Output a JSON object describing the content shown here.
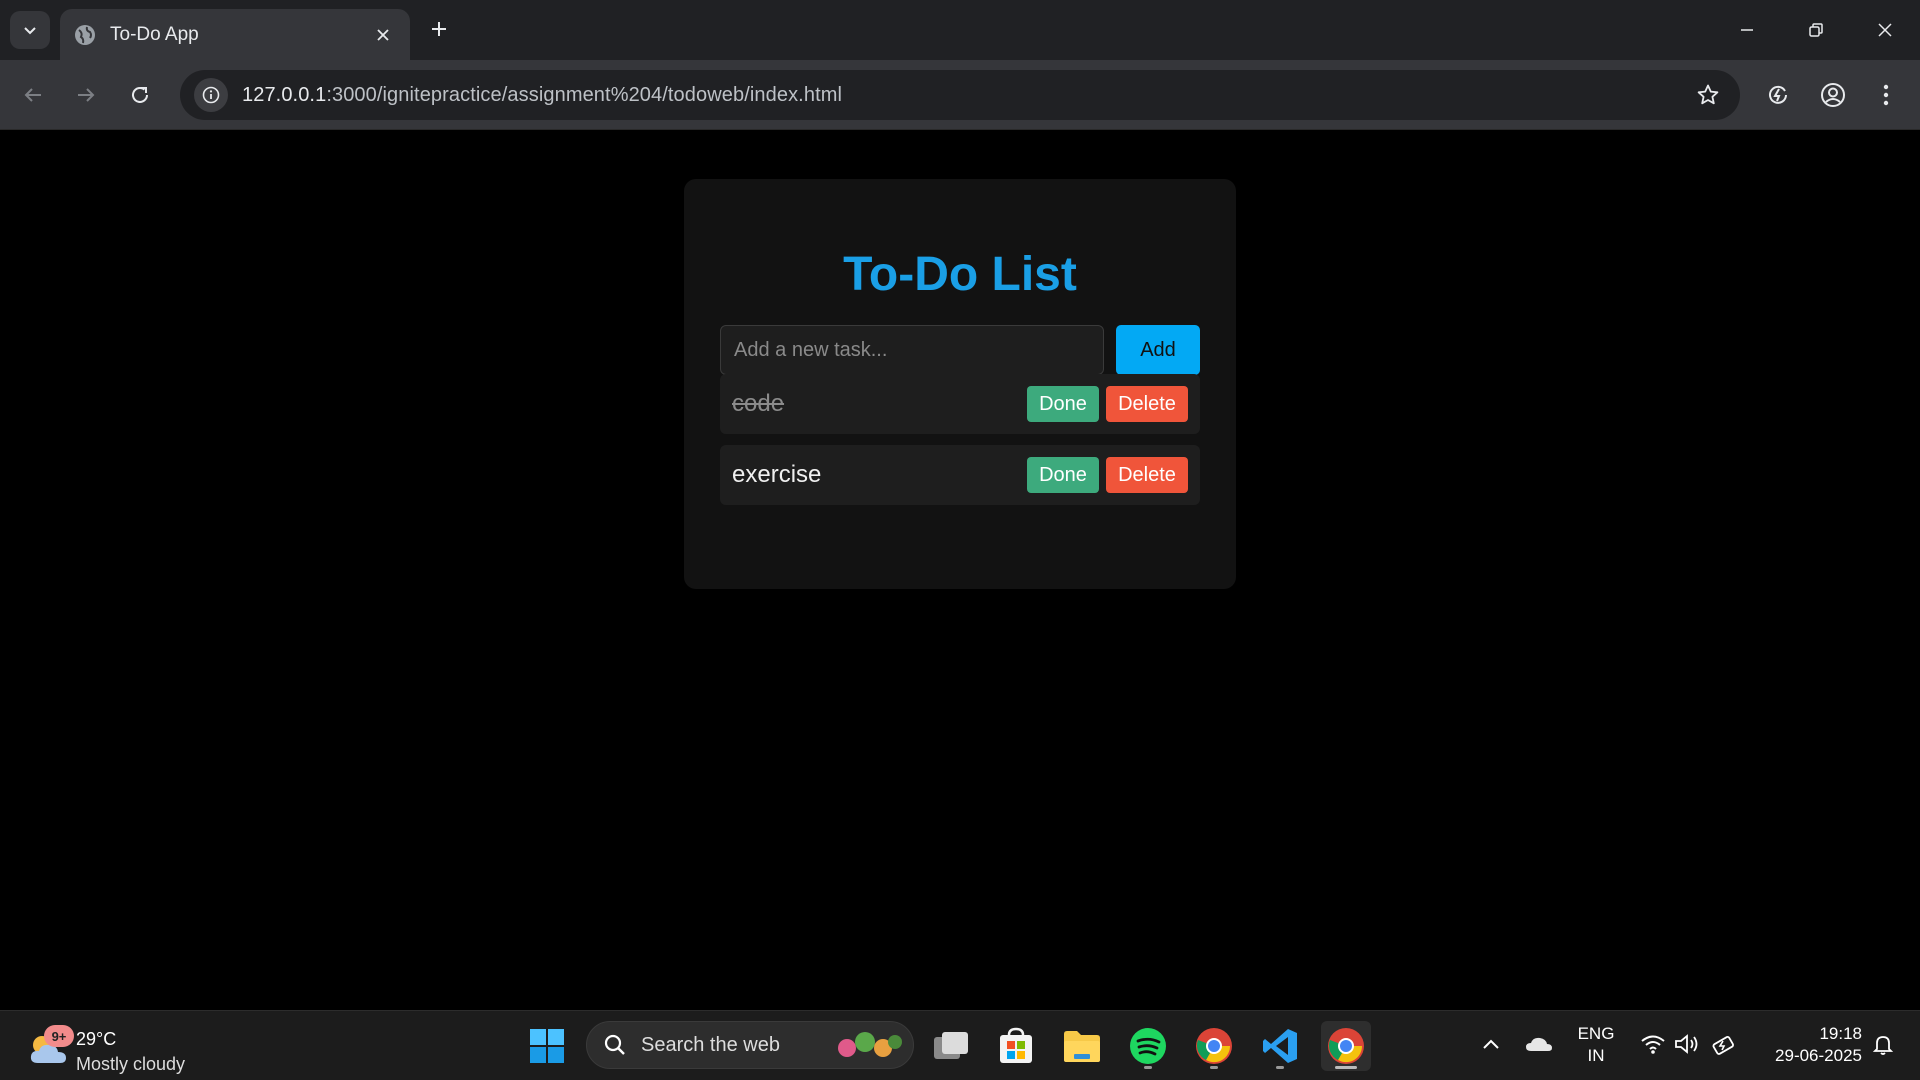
{
  "browser": {
    "tab_title": "To-Do App",
    "url_host": "127.0.0.1",
    "url_rest": ":3000/ignitepractice/assignment%204/todoweb/index.html"
  },
  "app": {
    "title": "To-Do List",
    "input_placeholder": "Add a new task...",
    "input_value": "",
    "add_label": "Add",
    "tasks": [
      {
        "text": "code",
        "completed": true,
        "done_label": "Done",
        "delete_label": "Delete"
      },
      {
        "text": "exercise",
        "completed": false,
        "done_label": "Done",
        "delete_label": "Delete"
      }
    ]
  },
  "taskbar": {
    "weather_badge": "9+",
    "weather_temp": "29°C",
    "weather_condition": "Mostly cloudy",
    "search_label": "Search the web",
    "lang_line1": "ENG",
    "lang_line2": "IN",
    "time": "19:18",
    "date": "29-06-2025"
  },
  "colors": {
    "accent": "#1a9fe6",
    "add_button": "#03a9f4",
    "done_button": "#3daa7d",
    "delete_button": "#f0553a"
  }
}
